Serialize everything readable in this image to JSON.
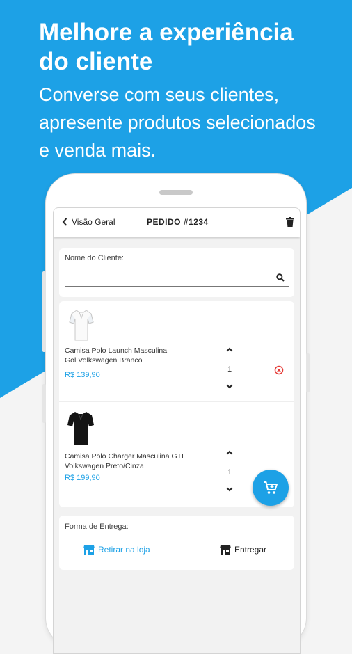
{
  "colors": {
    "brand": "#1da1e6",
    "background_light": "#f4f4f4",
    "danger": "#e53935"
  },
  "hero": {
    "headline_line1": "Melhore a experiência",
    "headline_line2": "do cliente",
    "sub_line1": "Converse com seus clientes,",
    "sub_line2": "apresente produtos selecionados",
    "sub_line3": "e venda mais."
  },
  "appbar": {
    "back_label": "Visão Geral",
    "title": "PEDIDO #1234",
    "back_icon": "chevron-left-icon",
    "action_icon": "trash-icon"
  },
  "customer": {
    "label": "Nome do Cliente:",
    "value": "",
    "search_icon": "search-icon"
  },
  "cart_items": [
    {
      "name_line1": "Camisa Polo Launch Masculina",
      "name_line2": "Gol Volkswagen Branco",
      "price": "R$ 139,90",
      "qty": "1",
      "image_icon": "white-polo-shirt-icon"
    },
    {
      "name_line1": "Camisa Polo Charger Masculina GTI",
      "name_line2": "Volkswagen Preto/Cinza",
      "price": "R$ 199,90",
      "qty": "1",
      "image_icon": "black-polo-shirt-icon"
    }
  ],
  "delivery": {
    "label": "Forma de Entrega:",
    "option_pickup": "Retirar na loja",
    "option_deliver": "Entregar"
  }
}
